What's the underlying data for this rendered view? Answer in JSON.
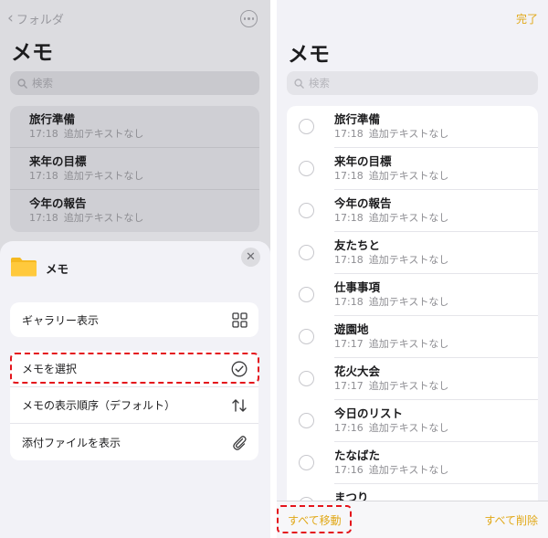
{
  "left": {
    "back_label": "フォルダ",
    "title": "メモ",
    "search_placeholder": "検索",
    "notes": [
      {
        "title": "旅行準備",
        "time": "17:18",
        "subtitle": "追加テキストなし"
      },
      {
        "title": "来年の目標",
        "time": "17:18",
        "subtitle": "追加テキストなし"
      },
      {
        "title": "今年の報告",
        "time": "17:18",
        "subtitle": "追加テキストなし"
      }
    ],
    "sheet": {
      "folder_name": "メモ",
      "gallery_label": "ギャラリー表示",
      "select_label": "メモを選択",
      "sort_label": "メモの表示順序（デフォルト）",
      "attachments_label": "添付ファイルを表示"
    }
  },
  "right": {
    "done_label": "完了",
    "title": "メモ",
    "search_placeholder": "検索",
    "notes": [
      {
        "title": "旅行準備",
        "time": "17:18",
        "subtitle": "追加テキストなし"
      },
      {
        "title": "来年の目標",
        "time": "17:18",
        "subtitle": "追加テキストなし"
      },
      {
        "title": "今年の報告",
        "time": "17:18",
        "subtitle": "追加テキストなし"
      },
      {
        "title": "友たちと",
        "time": "17:18",
        "subtitle": "追加テキストなし"
      },
      {
        "title": "仕事事項",
        "time": "17:18",
        "subtitle": "追加テキストなし"
      },
      {
        "title": "遊園地",
        "time": "17:17",
        "subtitle": "追加テキストなし"
      },
      {
        "title": "花火大会",
        "time": "17:17",
        "subtitle": "追加テキストなし"
      },
      {
        "title": "今日のリスト",
        "time": "17:16",
        "subtitle": "追加テキストなし"
      },
      {
        "title": "たなばた",
        "time": "17:16",
        "subtitle": "追加テキストなし"
      },
      {
        "title": "まつり",
        "time": "",
        "subtitle": ""
      }
    ],
    "move_all_label": "すべて移動",
    "delete_all_label": "すべて削除"
  },
  "colors": {
    "accent": "#e1a817",
    "highlight": "#e4141b"
  }
}
